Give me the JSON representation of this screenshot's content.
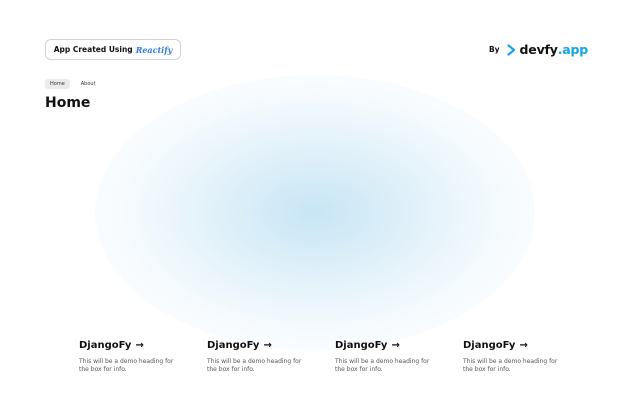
{
  "header": {
    "pill_prefix": "App Created Using",
    "pill_brand": "Reactify",
    "by_label": "By",
    "logo_main": "devfy",
    "logo_accent": ".app"
  },
  "nav": {
    "items": [
      {
        "label": "Home",
        "active": true
      },
      {
        "label": "About",
        "active": false
      }
    ]
  },
  "page": {
    "title": "Home"
  },
  "cards": [
    {
      "title": "DjangoFy",
      "arrow": "→",
      "desc": "This will be a demo heading for the box for info."
    },
    {
      "title": "DjangoFy",
      "arrow": "→",
      "desc": "This will be a demo heading for the box for info."
    },
    {
      "title": "DjangoFy",
      "arrow": "→",
      "desc": "This will be a demo heading for the box for info."
    },
    {
      "title": "DjangoFy",
      "arrow": "→",
      "desc": "This will be a demo heading for the box for info."
    }
  ],
  "colors": {
    "brand_accent": "#16a5e0",
    "reactify_brand": "#2b7be4",
    "glow": "#c4e4f4"
  },
  "icons": {
    "logo_chevron": "chevron-right-icon",
    "card_arrow": "arrow-right-icon"
  }
}
